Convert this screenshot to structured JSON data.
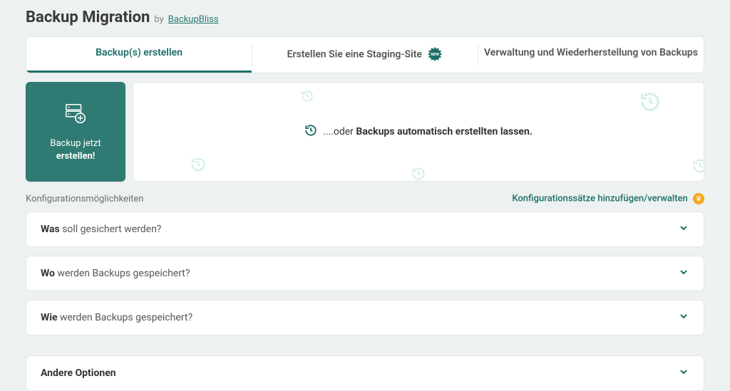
{
  "header": {
    "title": "Backup Migration",
    "by": "by",
    "author": "BackupBliss"
  },
  "tabs": {
    "create": "Backup(s) erstellen",
    "staging": "Erstellen Sie eine Staging-Site",
    "staging_badge": "NEW",
    "manage": "Verwaltung und Wiederherstellung von Backups"
  },
  "hero": {
    "create_line1": "Backup jetzt",
    "create_line2": "erstellen!",
    "auto_prefix": "....oder ",
    "auto_bold": "Backups automatisch erstellten lassen."
  },
  "config": {
    "left": "Konfigurationsmöglichkeiten",
    "right": "Konfigurationssätze hinzufügen/verwalten"
  },
  "accordion": {
    "what_bold": "Was",
    "what_rest": " soll gesichert werden?",
    "where_bold": "Wo",
    "where_rest": " werden Backups gespeichert?",
    "how_bold": "Wie",
    "how_rest": " werden Backups gespeichert?",
    "other": "Andere Optionen"
  }
}
